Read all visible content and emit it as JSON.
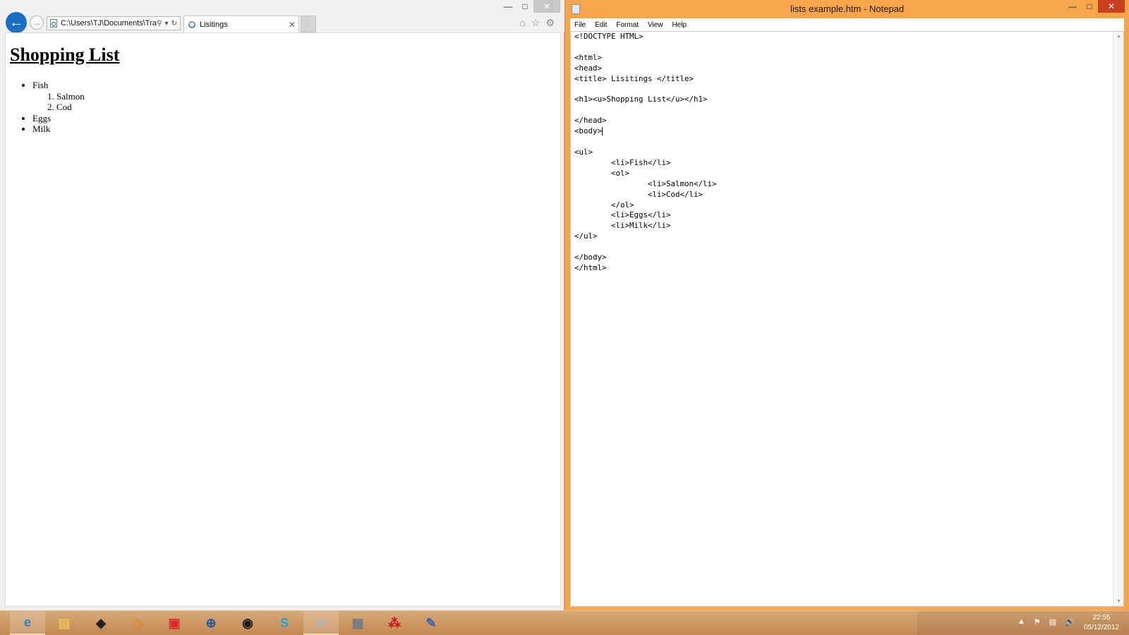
{
  "browser": {
    "address": "C:\\Users\\TJ\\Documents\\Tra",
    "tab_title": "Lisitings",
    "page": {
      "heading": "Shopping List",
      "items": [
        {
          "label": "Fish",
          "subitems": [
            "Salmon",
            "Cod"
          ]
        },
        {
          "label": "Eggs"
        },
        {
          "label": "Milk"
        }
      ]
    }
  },
  "notepad": {
    "title": "lists example.htm - Notepad",
    "menu": [
      "File",
      "Edit",
      "Format",
      "View",
      "Help"
    ],
    "lines": [
      "<!DOCTYPE HTML>",
      "",
      "<html>",
      "<head>",
      "<title> Lisitings </title>",
      "",
      "<h1><u>Shopping List</u></h1>",
      "",
      "</head>",
      "<body>",
      "",
      "<ul>",
      "\t<li>Fish</li>",
      "\t<ol>",
      "\t\t<li>Salmon</li>",
      "\t\t<li>Cod</li>",
      "\t</ol>",
      "\t<li>Eggs</li>",
      "\t<li>Milk</li>",
      "</ul>",
      "",
      "</body>",
      "</html>"
    ]
  },
  "taskbar": {
    "apps": [
      {
        "icon": "internet-explorer-icon",
        "color": "#1e88d8"
      },
      {
        "icon": "file-explorer-icon",
        "color": "#e8c25a"
      },
      {
        "icon": "unity-icon",
        "color": "#222222"
      },
      {
        "icon": "blender-like-icon",
        "color": "#e08a1e"
      },
      {
        "icon": "sketchup-icon",
        "color": "#d8262a"
      },
      {
        "icon": "network-app-icon",
        "color": "#1f5aa0"
      },
      {
        "icon": "steam-icon",
        "color": "#1b1b1b"
      },
      {
        "icon": "skype-icon",
        "color": "#16a7e8"
      },
      {
        "icon": "notepad-icon",
        "color": "#8fb8d6"
      },
      {
        "icon": "calculator-icon",
        "color": "#6f7d8a"
      },
      {
        "icon": "adobe-reader-icon",
        "color": "#c8141b"
      },
      {
        "icon": "paint-icon",
        "color": "#3a63b8"
      }
    ],
    "clock": {
      "time": "22:55",
      "date": "05/12/2012"
    }
  }
}
